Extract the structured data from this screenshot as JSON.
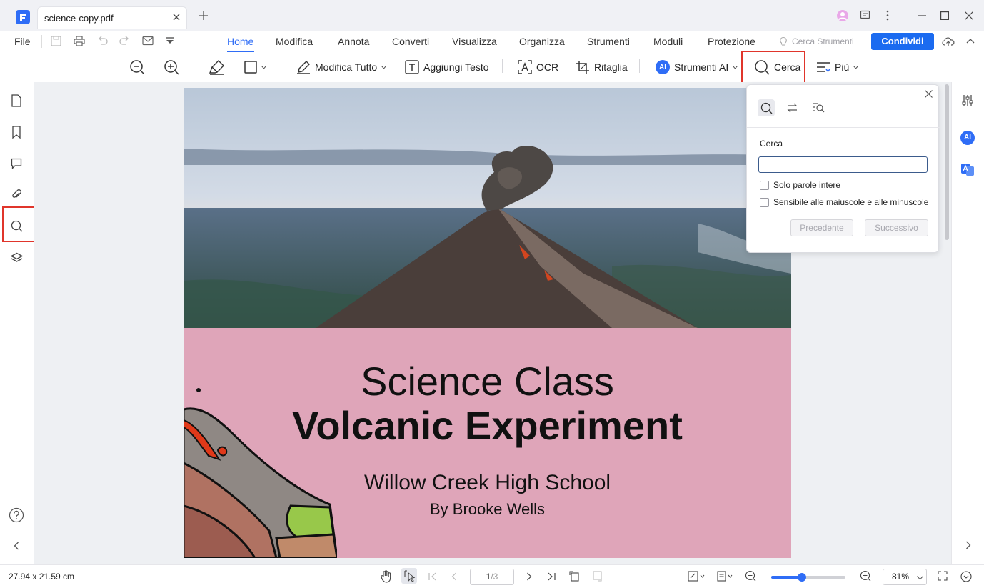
{
  "colors": {
    "accent": "#2f6df6",
    "highlight": "#e0352b",
    "page_pink": "#dfa5b9",
    "share_bg": "#1b6bf0"
  },
  "tab": {
    "title": "science-copy.pdf"
  },
  "menu": {
    "file": "File",
    "tabs": [
      {
        "label": "Home",
        "active": true
      },
      {
        "label": "Modifica"
      },
      {
        "label": "Annota"
      },
      {
        "label": "Converti"
      },
      {
        "label": "Visualizza"
      },
      {
        "label": "Organizza"
      },
      {
        "label": "Strumenti"
      },
      {
        "label": "Moduli"
      },
      {
        "label": "Protezione"
      }
    ],
    "search_tools": "Cerca Strumenti",
    "share": "Condividi"
  },
  "toolbar": {
    "edit_all": "Modifica Tutto",
    "add_text": "Aggiungi Testo",
    "ocr": "OCR",
    "crop": "Ritaglia",
    "ai_tools": "Strumenti AI",
    "ai_badge": "AI",
    "search": "Cerca",
    "more": "Più"
  },
  "search_panel": {
    "label": "Cerca",
    "input_value": "",
    "whole_words": "Solo parole intere",
    "match_case": "Sensibile alle maiuscole e alle minuscole",
    "prev": "Precedente",
    "next": "Successivo"
  },
  "document": {
    "title_line1": "Science Class",
    "title_line2": "Volcanic Experiment",
    "school": "Willow Creek High School",
    "author": "By Brooke Wells"
  },
  "right_sidebar": {
    "ai_badge": "AI"
  },
  "status": {
    "dimensions": "27.94 x 21.59 cm",
    "page_current": "1",
    "page_total": "/3",
    "zoom": "81%",
    "zoom_fraction": 0.41
  }
}
